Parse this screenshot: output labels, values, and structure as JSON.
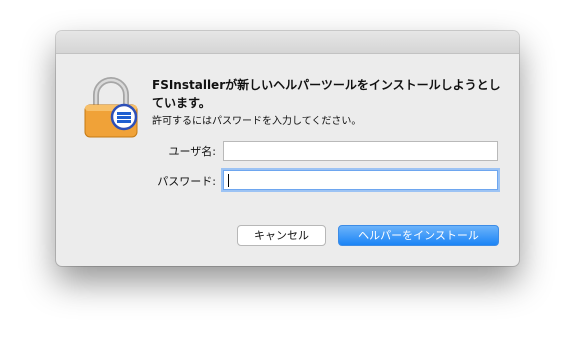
{
  "dialog": {
    "message": "FSInstallerが新しいヘルパーツールをインストールしようとしています。",
    "info": "許可するにはパスワードを入力してください。",
    "username_label": "ユーザ名:",
    "username_value": "",
    "password_label": "パスワード:",
    "password_value": "",
    "cancel_label": "キャンセル",
    "install_label": "ヘルパーをインストール"
  },
  "colors": {
    "primary_button": "#1b84f6",
    "focus_ring": "#9cc3f4",
    "lock_body": "#f0a238"
  },
  "icons": {
    "app_icon": "lock-icon",
    "app_badge": "fsinstaller-badge-icon"
  }
}
